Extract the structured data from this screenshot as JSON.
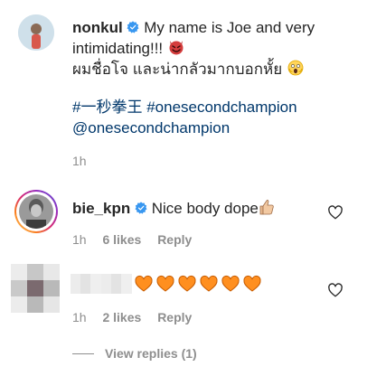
{
  "post": {
    "username": "nonkul",
    "caption_line1": "My name is Joe and very",
    "caption_line2": "intimidating!!!",
    "caption_line3": "ผมชื่อโจ และน่ากลัวมากบอกหั้ย",
    "hashtag1": "#一秒拳王",
    "hashtag2": "#onesecondchampion",
    "mention": "@onesecondchampion",
    "time": "1h"
  },
  "comments": [
    {
      "username": "bie_kpn",
      "text": "Nice body dope",
      "time": "1h",
      "likes": "6 likes",
      "reply": "Reply"
    },
    {
      "username": "",
      "hearts": 6,
      "time": "1h",
      "likes": "2 likes",
      "reply": "Reply"
    }
  ],
  "view_replies": "View replies (1)",
  "colors": {
    "verified": "#3897f0",
    "link": "#00376b",
    "meta": "#8e8e8e",
    "heart": "#ff8f1f",
    "story_ring": "#d62976"
  },
  "icons": {
    "verified": "verified-badge-icon",
    "heart_outline": "heart-outline-icon",
    "devil": "smiling-devil-emoji",
    "scream": "face-screaming-emoji",
    "thumbs": "thumbs-up-emoji",
    "orange_heart": "orange-heart-emoji"
  }
}
